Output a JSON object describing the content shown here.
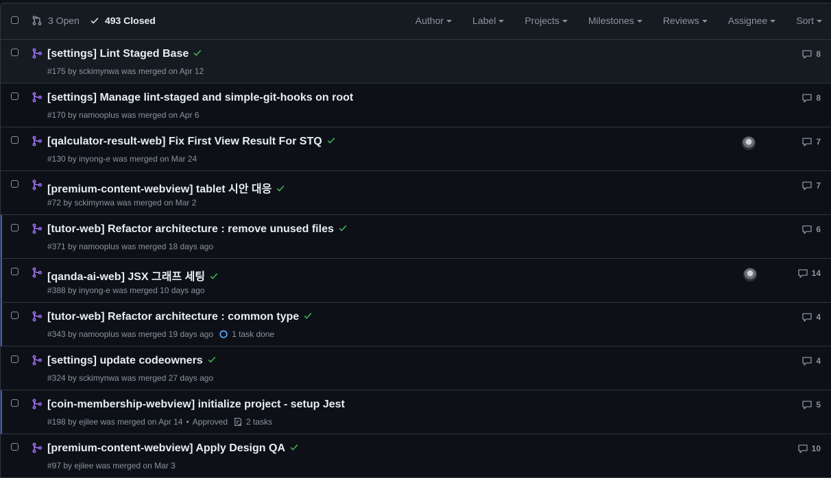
{
  "header": {
    "open_label": "3 Open",
    "closed_label": "493 Closed",
    "filters": [
      "Author",
      "Label",
      "Projects",
      "Milestones",
      "Reviews",
      "Assignee",
      "Sort"
    ]
  },
  "colors": {
    "background": "#0d1117",
    "merged_purple": "#a371f7",
    "check_green": "#3fb950",
    "accent_blue": "#2f5fd0",
    "muted": "#8b949e"
  },
  "prs": [
    {
      "title": "[settings] Lint Staged Base",
      "check": true,
      "meta": "#175 by sckimynwa was merged on Apr 12",
      "comments": "8",
      "avatar": false,
      "marked": false
    },
    {
      "title": "[settings] Manage lint-staged and simple-git-hooks on root",
      "check": false,
      "meta": "#170 by namooplus was merged on Apr 6",
      "comments": "8",
      "avatar": false,
      "marked": false
    },
    {
      "title": "[qalculator-result-web] Fix First View Result For STQ",
      "check": true,
      "meta": "#130 by inyong-e was merged on Mar 24",
      "comments": "7",
      "avatar": true,
      "marked": false
    },
    {
      "title": "[premium-content-webview] tablet 시안 대응",
      "check": true,
      "meta": "#72 by sckimynwa was merged on Mar 2",
      "comments": "7",
      "avatar": false,
      "marked": false
    },
    {
      "title": "[tutor-web] Refactor architecture : remove unused files",
      "check": true,
      "meta": "#371 by namooplus was merged 18 days ago",
      "comments": "6",
      "avatar": false,
      "marked": true
    },
    {
      "title": "[qanda-ai-web] JSX 그래프 세팅",
      "check": true,
      "meta": "#388 by inyong-e was merged 10 days ago",
      "comments": "14",
      "avatar": true,
      "marked": true
    },
    {
      "title": "[tutor-web] Refactor architecture : common type",
      "check": true,
      "meta": "#343 by namooplus was merged 19 days ago",
      "task": "1 task done",
      "task_icon": "progress-circle-icon",
      "comments": "4",
      "avatar": false,
      "marked": true
    },
    {
      "title": "[settings] update codeowners",
      "check": true,
      "meta": "#324 by sckimynwa was merged 27 days ago",
      "comments": "4",
      "avatar": false,
      "marked": false
    },
    {
      "title": "[coin-membership-webview] initialize project - setup Jest",
      "check": false,
      "meta": "#198 by ejilee was merged on Apr 14",
      "approved": "Approved",
      "task": "2 tasks",
      "task_icon": "checklist-icon",
      "comments": "5",
      "avatar": false,
      "marked": true
    },
    {
      "title": "[premium-content-webview] Apply Design QA",
      "check": true,
      "meta": "#97 by ejilee was merged on Mar 3",
      "comments": "10",
      "avatar": false,
      "marked": false
    }
  ]
}
